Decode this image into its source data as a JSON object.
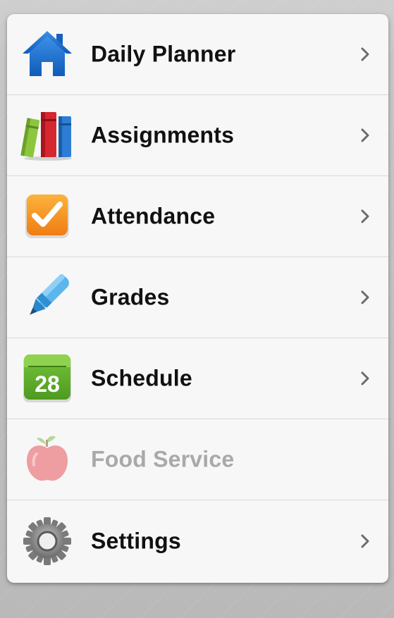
{
  "menu": {
    "items": [
      {
        "label": "Daily Planner",
        "icon": "house-icon",
        "enabled": true
      },
      {
        "label": "Assignments",
        "icon": "books-icon",
        "enabled": true
      },
      {
        "label": "Attendance",
        "icon": "checkmark-icon",
        "enabled": true
      },
      {
        "label": "Grades",
        "icon": "pen-icon",
        "enabled": true
      },
      {
        "label": "Schedule",
        "icon": "calendar-icon",
        "calendar_day": "28",
        "enabled": true
      },
      {
        "label": "Food Service",
        "icon": "apple-icon",
        "enabled": false
      },
      {
        "label": "Settings",
        "icon": "gear-icon",
        "enabled": true
      }
    ]
  },
  "colors": {
    "house_blue": "#1a6fd1",
    "attendance_orange": "#f5901e",
    "calendar_green": "#5fae2c",
    "disabled_text": "#a9a9a9"
  }
}
